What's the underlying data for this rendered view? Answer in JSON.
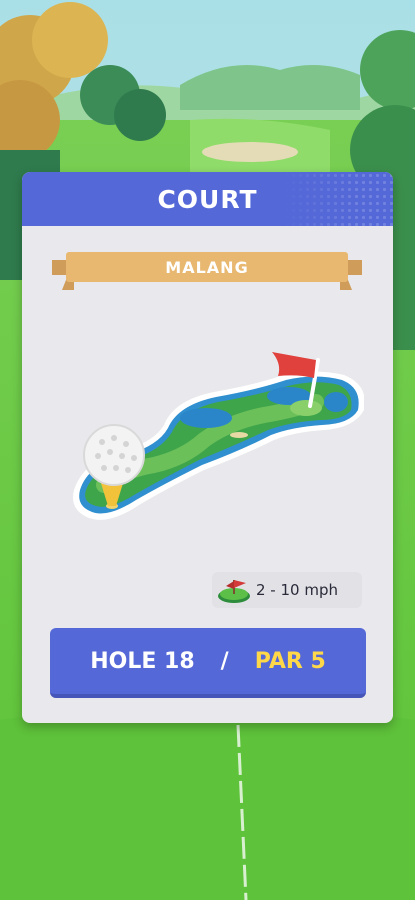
{
  "card": {
    "title": "COURT",
    "course_name": "MALANG"
  },
  "wind": {
    "icon": "wind-flag-icon",
    "speed_range": "2 - 10 mph"
  },
  "hole": {
    "label": "HOLE 18",
    "separator": "/",
    "par_label": "PAR 5"
  },
  "colors": {
    "header_blue": "#5468d8",
    "par_yellow": "#ffd84a",
    "ribbon": "#e8b870",
    "card_bg": "#e9e9ed"
  }
}
